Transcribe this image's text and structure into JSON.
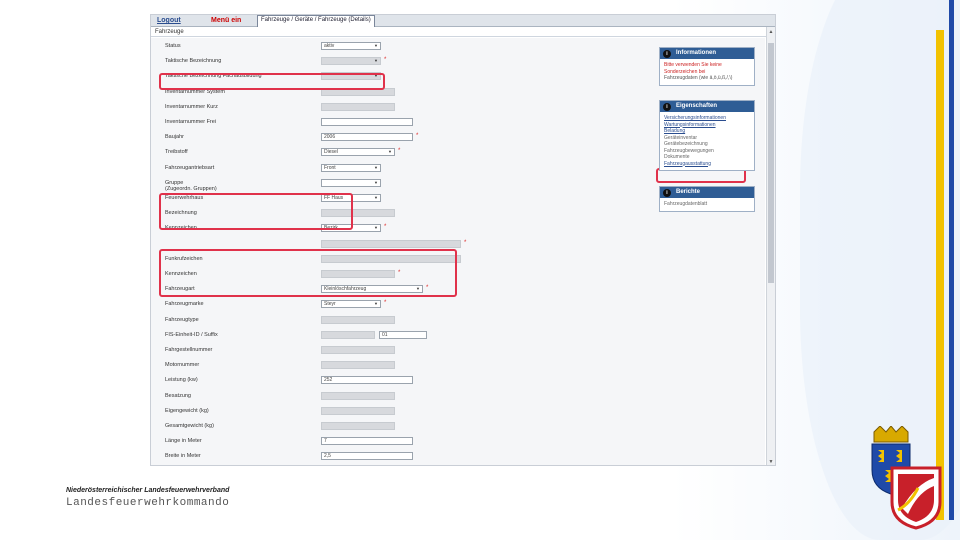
{
  "window": {
    "logout_label": "Logout",
    "menu_label": "Menü ein",
    "breadcrumb": "Fahrzeuge / Geräte / Fahrzeuge (Details)",
    "subtitle": "Fahrzeuge"
  },
  "form": {
    "rows": [
      {
        "label": "Status",
        "value": "aktiv",
        "kind": "select",
        "required": false
      },
      {
        "label": "Taktische Bezeichnung",
        "value": "",
        "kind": "select-blur",
        "required": true
      },
      {
        "label": "Taktische Bezeichnung Fachausbildung",
        "value": "",
        "kind": "select-blur",
        "required": false
      },
      {
        "label": "Inventarnummer System",
        "value": "",
        "kind": "blur",
        "required": false
      },
      {
        "label": "Inventarnummer Kurz",
        "value": "",
        "kind": "blur",
        "required": false
      },
      {
        "label": "Inventarnummer Frei",
        "value": "",
        "kind": "text",
        "required": false
      },
      {
        "label": "Baujahr",
        "value": "2006",
        "kind": "text",
        "required": true
      },
      {
        "label": "Treibstoff",
        "value": "Diesel",
        "kind": "select",
        "required": true
      },
      {
        "label": "Fahrzeugantriebsart",
        "value": "Front",
        "kind": "select",
        "required": false
      },
      {
        "label": "Gruppe\n(Zugeordn. Gruppen)",
        "value": "",
        "kind": "select",
        "required": false
      },
      {
        "label": "Feuerwehrhaus",
        "value": "FF Haus",
        "kind": "select",
        "required": false
      },
      {
        "label": "Bezeichnung",
        "value": "",
        "kind": "blur",
        "required": false
      },
      {
        "label": "Kennzeichen",
        "value": "Bezirk",
        "kind": "select",
        "required": true
      },
      {
        "label": "",
        "value": "",
        "kind": "blur",
        "required": true
      },
      {
        "label": "Funkrufzeichen",
        "value": "",
        "kind": "blur",
        "required": false
      },
      {
        "label": "Kennzeichen",
        "value": "",
        "kind": "blur",
        "required": true
      },
      {
        "label": "Fahrzeugart",
        "value": "Kleinlöschfahrzeug",
        "kind": "select",
        "required": true
      },
      {
        "label": "Fahrzeugmarke",
        "value": "Steyr",
        "kind": "select",
        "required": true
      },
      {
        "label": "Fahrzeugtype",
        "value": "",
        "kind": "blur",
        "required": false
      },
      {
        "label": "FIS-Einheit-ID / Suffix",
        "value": "01",
        "kind": "split",
        "required": false
      },
      {
        "label": "Fahrgestellnummer",
        "value": "",
        "kind": "blur",
        "required": false
      },
      {
        "label": "Motornummer",
        "value": "",
        "kind": "blur",
        "required": false
      },
      {
        "label": "Leistung (kw)",
        "value": "252",
        "kind": "text",
        "required": false
      },
      {
        "label": "Besatzung",
        "value": "",
        "kind": "blur",
        "required": false
      },
      {
        "label": "Eigengewicht (kg)",
        "value": "",
        "kind": "blur",
        "required": false
      },
      {
        "label": "Gesamtgewicht (kg)",
        "value": "",
        "kind": "blur",
        "required": false
      },
      {
        "label": "Länge in Meter",
        "value": "7",
        "kind": "text",
        "required": false
      },
      {
        "label": "Breite in Meter",
        "value": "2,5",
        "kind": "text",
        "required": false
      }
    ]
  },
  "panels": {
    "info": {
      "title": "Informationen",
      "lines": [
        "Bitte verwenden Sie keine",
        "Sonderzeichen bei",
        "Fahrzeugdaten (wie ä,ö,ü,ß,/,\\)"
      ]
    },
    "features": {
      "title": "Eigenschaften",
      "items": [
        "Versicherungsinformationen",
        "Wartungsinformationen",
        "Beladung",
        "Geräteinventar",
        "Gerätebezeichnung",
        "Fahrzeugbewegungen",
        "Dokumente",
        "Fahrzeugausstattung"
      ]
    },
    "reports": {
      "title": "Berichte",
      "items": [
        "Fahrzeugdatenblatt"
      ]
    }
  },
  "footer": {
    "organization": "Niederösterreichischer Landesfeuerwehrverband",
    "command": "Landesfeuerwehrkommando"
  },
  "colors": {
    "accent_blue": "#2f5d95",
    "highlight_red": "#e0324b",
    "brand_yellow": "#f2c200",
    "brand_blue": "#1f4aa8"
  }
}
